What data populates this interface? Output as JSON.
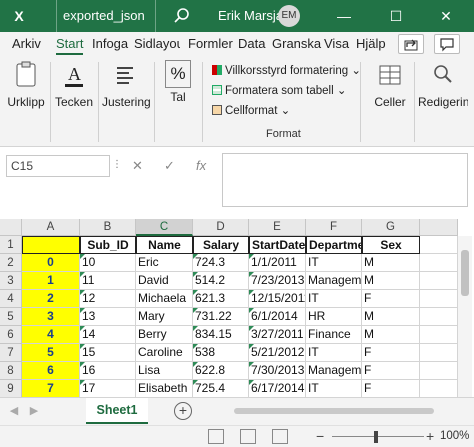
{
  "app": {
    "logo_text": "X",
    "filename": "exported_json",
    "username": "Erik Marsja",
    "avatar_initials": "EM",
    "accent_color": "#217346"
  },
  "window_controls": {
    "minimize": "—",
    "maximize": "☐",
    "close": "✕"
  },
  "tabs": [
    "Arkiv",
    "Start",
    "Infoga",
    "Sidlayout",
    "Formler",
    "Data",
    "Granska",
    "Visa",
    "Hjälp"
  ],
  "active_tab": "Start",
  "ribbon": {
    "clipboard": "Urklipp",
    "font": "Tecken",
    "alignment": "Justering",
    "number": "Tal",
    "number_symbol": "%",
    "conditional_formatting": "Villkorsstyrd formatering",
    "format_as_table": "Formatera som tabell",
    "cell_styles": "Cellformat",
    "styles_group": "Format",
    "cells": "Celler",
    "editing": "Redigering"
  },
  "formula_bar": {
    "name_box": "C15",
    "cancel": "✕",
    "enter": "✓",
    "fx": "fx",
    "formula": ""
  },
  "grid": {
    "columns": [
      "A",
      "B",
      "C",
      "D",
      "E",
      "F",
      "G"
    ],
    "selected_column": "C",
    "rows": [
      "1",
      "2",
      "3",
      "4",
      "5",
      "6",
      "7",
      "8",
      "9"
    ],
    "header_row": {
      "A": "",
      "B": "Sub_ID",
      "C": "Name",
      "D": "Salary",
      "E": "StartDate",
      "F": "Department",
      "G": "Sex"
    },
    "data": [
      {
        "index": "0",
        "id": "10",
        "name": "Eric",
        "salary": "724.3",
        "date": "1/1/2011",
        "dept": "IT",
        "sex": "M"
      },
      {
        "index": "1",
        "id": "11",
        "name": "David",
        "salary": "514.2",
        "date": "7/23/2013",
        "dept": "Management",
        "sex": "M"
      },
      {
        "index": "2",
        "id": "12",
        "name": "Michaela",
        "salary": "621.3",
        "date": "12/15/2011",
        "dept": "IT",
        "sex": "F"
      },
      {
        "index": "3",
        "id": "13",
        "name": "Mary",
        "salary": "731.22",
        "date": "6/1/2014",
        "dept": "HR",
        "sex": "M"
      },
      {
        "index": "4",
        "id": "14",
        "name": "Berry",
        "salary": "834.15",
        "date": "3/27/2011",
        "dept": "Finance",
        "sex": "M"
      },
      {
        "index": "5",
        "id": "15",
        "name": "Caroline",
        "salary": "538",
        "date": "5/21/2012",
        "dept": "IT",
        "sex": "F"
      },
      {
        "index": "6",
        "id": "16",
        "name": "Lisa",
        "salary": "622.8",
        "date": "7/30/2013",
        "dept": "Management",
        "sex": "F"
      },
      {
        "index": "7",
        "id": "17",
        "name": "Elisabeth",
        "salary": "725.4",
        "date": "6/17/2014",
        "dept": "IT",
        "sex": "F"
      }
    ]
  },
  "sheets": [
    "Sheet1"
  ],
  "active_sheet": "Sheet1",
  "add_sheet": "+",
  "status": {
    "zoom": "100%",
    "zoom_minus": "−",
    "zoom_plus": "+"
  }
}
